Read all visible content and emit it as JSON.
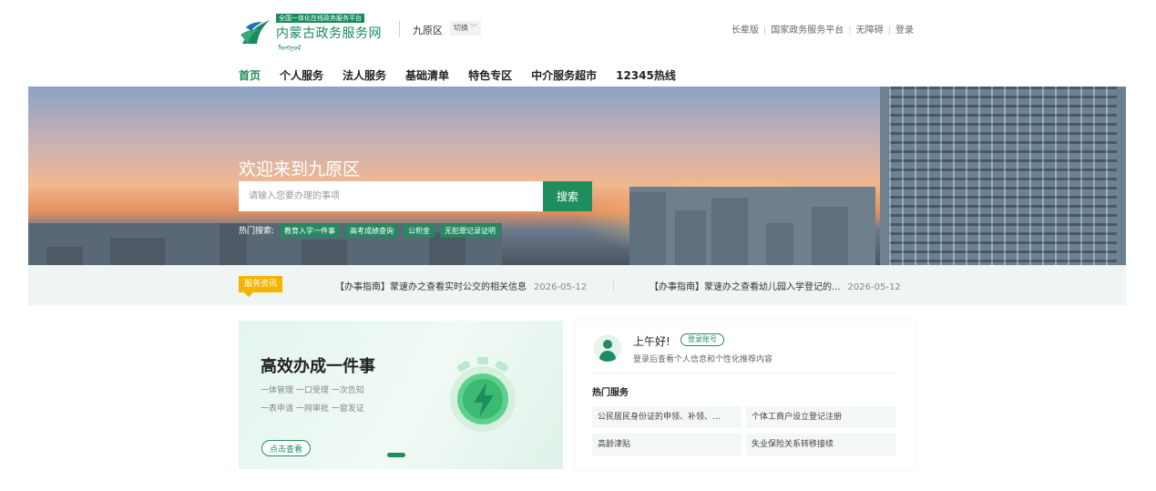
{
  "colors": {
    "brand": "#1f8e5e",
    "badge": "#f5b400",
    "ticker_bg": "#eef5f3"
  },
  "logo": {
    "tag": "全国一体化在线政务服务平台",
    "name": "内蒙古政务服务网",
    "mongol": "ᠮᠣᠩᠭᠣᠯ"
  },
  "header": {
    "region": "九原区",
    "switch_label": "切换",
    "links": [
      "长辈版",
      "国家政务服务平台",
      "无障碍",
      "登录"
    ]
  },
  "nav": [
    "首页",
    "个人服务",
    "法人服务",
    "基础清单",
    "特色专区",
    "中介服务超市",
    "12345热线"
  ],
  "banner": {
    "title": "欢迎来到九原区",
    "search_placeholder": "请输入您要办理的事项",
    "search_button": "搜索",
    "hot_label": "热门搜索:",
    "hot_tags": [
      "教育入学一件事",
      "高考成绩查询",
      "公积金",
      "无犯罪记录证明"
    ]
  },
  "ticker": {
    "badge": "服务资讯",
    "items": [
      {
        "title": "【办事指南】蒙速办之查看实时公交的相关信息",
        "date": "2026-05-12"
      },
      {
        "title": "【办事指南】蒙速办之查看幼儿园入学登记的...",
        "date": "2026-05-12"
      }
    ]
  },
  "promo": {
    "title": "高效办成一件事",
    "line1": "一体管理 一口受理 一次告知",
    "line2": "一表申请 一网审批 一窗发证",
    "button": "点击查看"
  },
  "user": {
    "greeting": "上午好!",
    "login_button": "登录账号",
    "subtitle": "登录后查看个人信息和个性化推荐内容",
    "hot_services_title": "热门服务",
    "services": [
      "公民居民身份证的申领、补领、...",
      "个体工商户设立登记注册",
      "高龄津贴",
      "失业保险关系转移接续"
    ]
  }
}
